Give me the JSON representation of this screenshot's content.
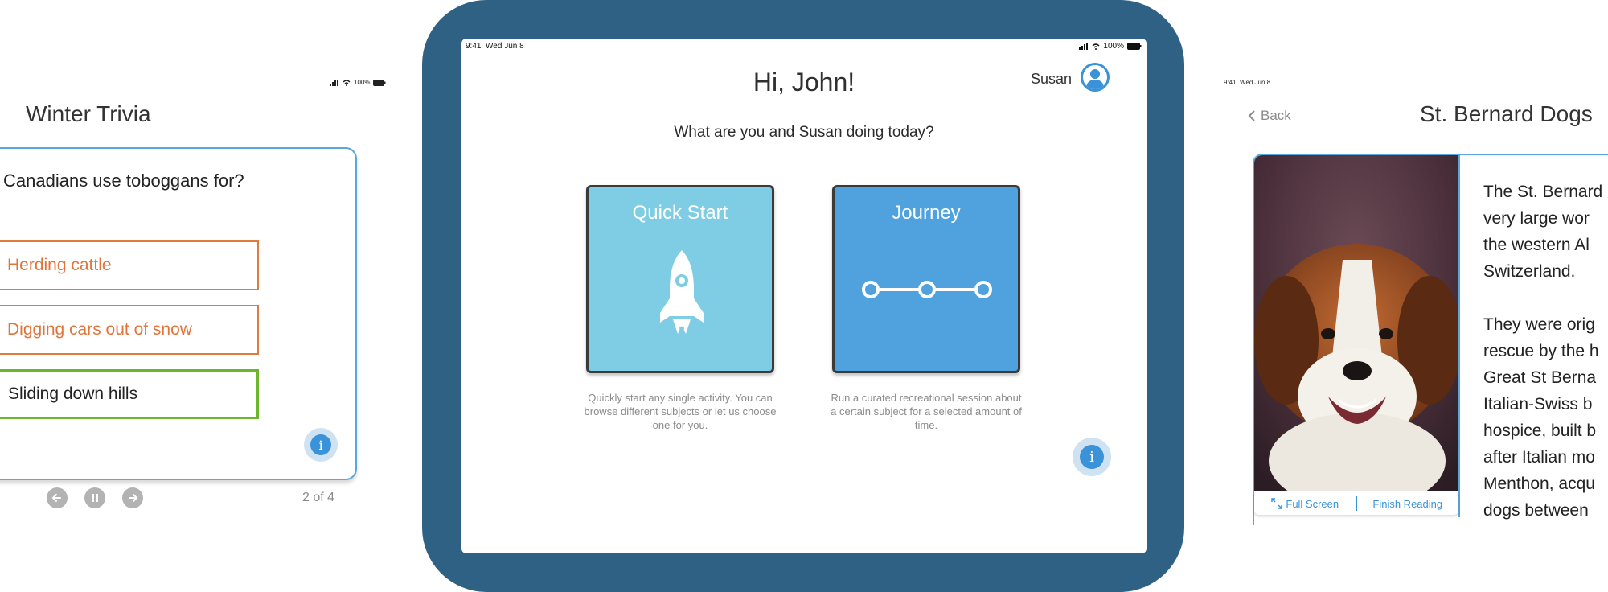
{
  "left_screen": {
    "status": {
      "battery": "100%"
    },
    "title": "Winter Trivia",
    "question": "Canadians use toboggans for?",
    "answers": [
      {
        "label": "Herding cattle",
        "state": "incorrect"
      },
      {
        "label": "Digging cars out of snow",
        "state": "incorrect"
      },
      {
        "label": "Sliding down hills",
        "state": "correct"
      }
    ],
    "info_label": "i",
    "controls": [
      "arrow-left-icon",
      "pause-icon",
      "arrow-right-icon"
    ],
    "page_count": "2 of 4"
  },
  "center_screen": {
    "status": {
      "time": "9:41",
      "date": "Wed Jun 8",
      "battery": "100%"
    },
    "greeting": "Hi, John!",
    "user_name": "Susan",
    "prompt": "What are you and Susan doing today?",
    "tiles": [
      {
        "label": "Quick Start",
        "icon": "rocket-icon",
        "color": "#7fcde4",
        "description": "Quickly start any single activity. You can browse different subjects or let us choose one for you."
      },
      {
        "label": "Journey",
        "icon": "journey-path-icon",
        "color": "#4fa2dd",
        "description": "Run a curated recreational session about a certain subject for a selected amount of time."
      }
    ],
    "info_label": "i"
  },
  "right_screen": {
    "status": {
      "time": "9:41",
      "date": "Wed Jun 8"
    },
    "back_label": "Back",
    "title": "St. Bernard Dogs",
    "full_screen_label": "Full Screen",
    "finish_reading_label": "Finish Reading",
    "paragraphs": [
      [
        "The St. Bernard",
        "very large wor",
        "the western Al",
        "Switzerland."
      ],
      [
        "They were orig",
        "rescue by the h",
        "Great St Berna",
        "Italian-Swiss b",
        "hospice, built b",
        "after Italian mo",
        "Menthon, acqu",
        "dogs between"
      ]
    ]
  },
  "colors": {
    "tablet_frame": "#2e6184",
    "accent_blue": "#3a92d8",
    "answer_orange": "#e2743a",
    "answer_green": "#6cb52d"
  }
}
